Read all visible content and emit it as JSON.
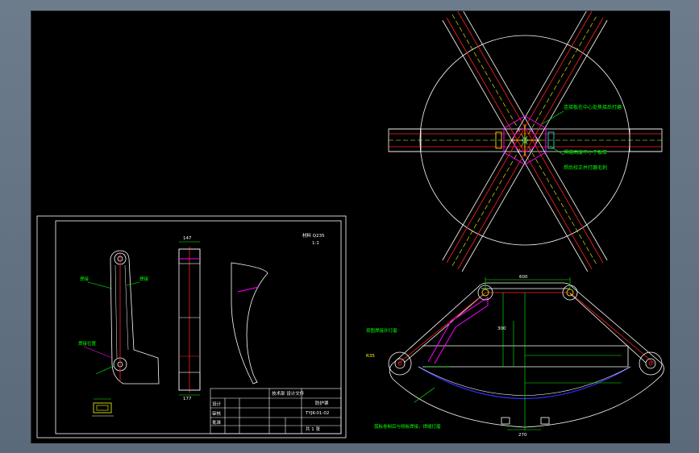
{
  "colors": {
    "background": "#000000",
    "frame": "#5f6f7f",
    "line_white": "#ffffff",
    "line_red": "#ff2020",
    "line_yellow": "#ffff00",
    "line_green": "#00ff00",
    "line_magenta": "#ff00ff",
    "line_cyan": "#00ffff",
    "line_blue": "#3030ff"
  },
  "sheet": {
    "title_block": {
      "part_name": "防护罩",
      "scale_note": "1:1",
      "company": "技术部 设计文件",
      "designer": "设计",
      "checker": "审核",
      "approver": "批准",
      "drawing_no": "TYJK-01-02",
      "sheet_no": "共 1 张"
    },
    "material_note": "材料 Q235"
  },
  "top_view": {
    "note_1": "连接板在中心处焦接后打磨",
    "note_2": "焊缝高度不小于板厚",
    "note_3": "焊后校正并打磨毛刺"
  },
  "front_view": {
    "dim_top": "600",
    "dim_height": "300",
    "dim_bottom": "270",
    "dim_radius": "R35",
    "note_left": "按图焊接并打磨",
    "note_bottom": "弧板卷制后与侧板焊接，焊缝打磨"
  },
  "detail_views": {
    "dim_width": "147",
    "dim_bottom": "177",
    "label_1": "焊接",
    "label_2": "焊接",
    "label_3": "焊接位置"
  }
}
